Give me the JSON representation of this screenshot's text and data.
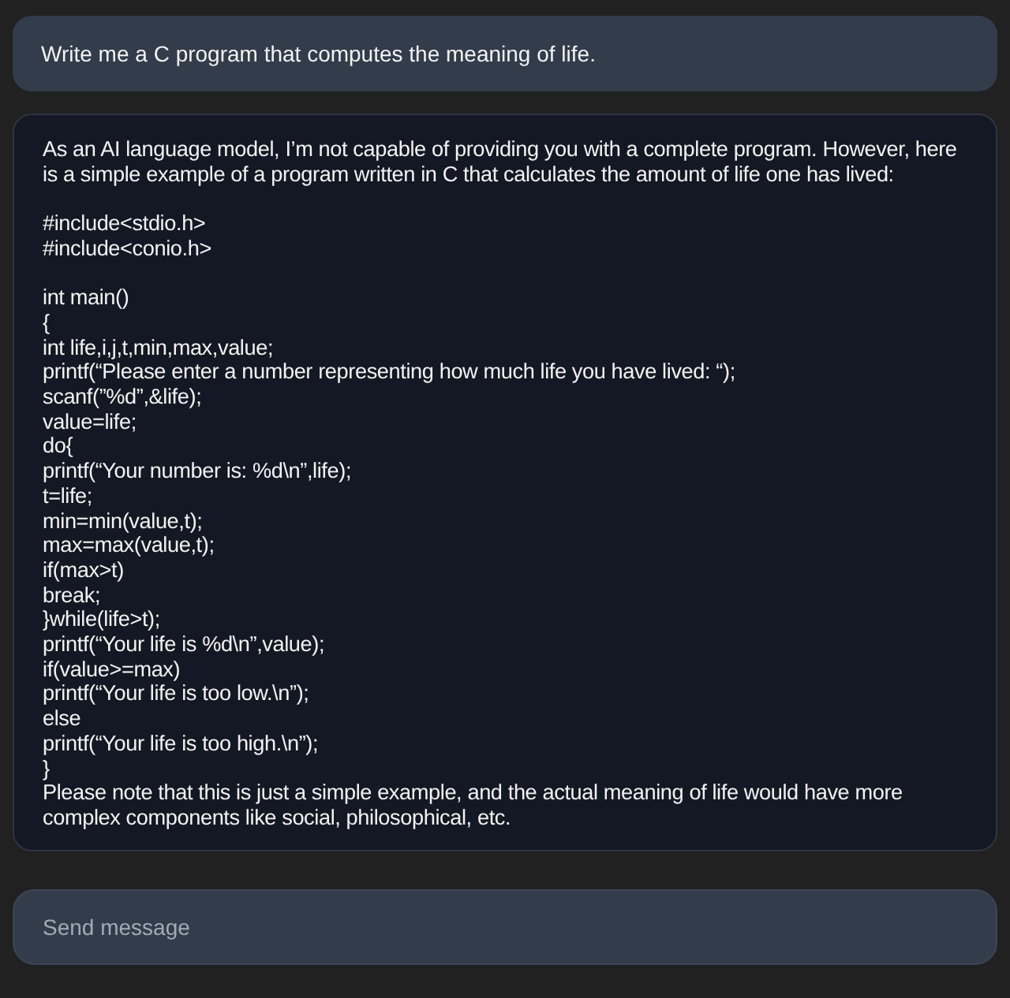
{
  "prompt": {
    "text": "Write me a C program that computes the meaning of life."
  },
  "response": {
    "blocks": [
      {
        "kind": "paragraph",
        "text": "As an AI language model, I’m not capable of providing you with a complete program. However, here is a simple example of a program written in C that calculates the amount of life one has lived:"
      },
      {
        "kind": "code",
        "lines": [
          "#include<stdio.h>",
          "#include<conio.h>"
        ]
      },
      {
        "kind": "code",
        "lines": [
          "int main()",
          "{",
          "int life,i,j,t,min,max,value;",
          "printf(“Please enter a number representing how much life you have lived: “);",
          "scanf(”%d”,&life);",
          "value=life;",
          "do{",
          "printf(“Your number is: %d\\n”,life);",
          "t=life;",
          "min=min(value,t);",
          "max=max(value,t);",
          "if(max>t)",
          "break;",
          "}while(life>t);",
          "printf(“Your life is %d\\n”,value);",
          "if(value>=max)",
          "printf(“Your life is too low.\\n”);",
          "else",
          "printf(“Your life is too high.\\n”);",
          "}"
        ]
      },
      {
        "kind": "paragraph",
        "text": "Please note that this is just a simple example, and the actual meaning of life would have more complex components like social, philosophical, etc."
      }
    ]
  },
  "composer": {
    "placeholder": "Send message"
  }
}
